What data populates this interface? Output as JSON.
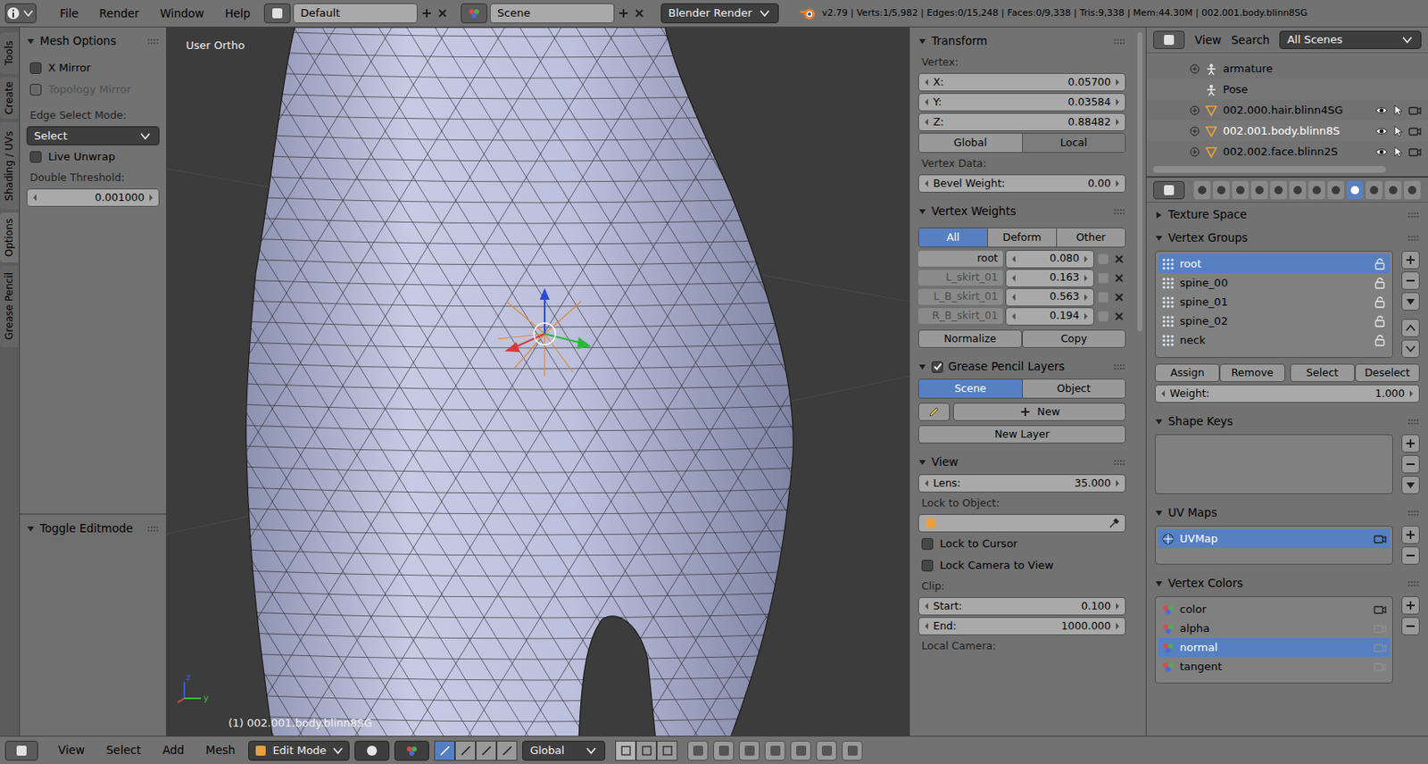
{
  "top_bar": {
    "menus": [
      "File",
      "Render",
      "Window",
      "Help"
    ],
    "layout": "Default",
    "scene": "Scene",
    "engine": "Blender Render",
    "stats": "v2.79 | Verts:1/5,982 | Edges:0/15,248 | Faces:0/9,338 | Tris:9,338 | Mem:44.30M | 002.001.body.blinn8SG"
  },
  "tool_tabs": [
    {
      "label": "Tools",
      "selected": false
    },
    {
      "label": "Create",
      "selected": false
    },
    {
      "label": "Shading / UVs",
      "selected": false
    },
    {
      "label": "Options",
      "selected": true
    },
    {
      "label": "Grease Pencil",
      "selected": false
    }
  ],
  "mesh_options": {
    "title": "Mesh Options",
    "expanded": true,
    "checkboxes": [
      {
        "label": "X Mirror",
        "checked": false,
        "disabled": false
      },
      {
        "label": "Topology Mirror",
        "checked": false,
        "disabled": true
      }
    ],
    "edge_select_label": "Edge Select Mode:",
    "edge_select_value": "Select",
    "live_unwrap": {
      "label": "Live Unwrap",
      "checked": false,
      "disabled": false
    },
    "threshold_label": "Double Threshold:",
    "threshold_value": "0.001000"
  },
  "operator_panel": {
    "title": "Toggle Editmode",
    "expanded": true
  },
  "viewport": {
    "view_name": "User Ortho",
    "object_info": "(1) 002.001.body.blinn8SG",
    "axis_labels": [
      "z",
      "y"
    ]
  },
  "transform": {
    "title": "Transform",
    "expanded": true,
    "vertex_label": "Vertex:",
    "coords": [
      {
        "label": "X:",
        "value": "0.05700"
      },
      {
        "label": "Y:",
        "value": "0.03584"
      },
      {
        "label": "Z:",
        "value": "0.88482"
      }
    ],
    "space": [
      {
        "label": "Global",
        "selected": false
      },
      {
        "label": "Local",
        "selected": true
      }
    ],
    "vertex_data_label": "Vertex Data:",
    "bevel": {
      "label": "Bevel Weight:",
      "value": "0.00"
    }
  },
  "vertex_weights": {
    "title": "Vertex Weights",
    "expanded": true,
    "filters": [
      {
        "label": "All",
        "selected": true
      },
      {
        "label": "Deform",
        "selected": false
      },
      {
        "label": "Other",
        "selected": false
      }
    ],
    "rows": [
      {
        "group": "root",
        "value": "0.080",
        "active": true
      },
      {
        "group": "L_skirt_01",
        "value": "0.163",
        "active": false
      },
      {
        "group": "L_B_skirt_01",
        "value": "0.563",
        "active": false
      },
      {
        "group": "R_B_skirt_01",
        "value": "0.194",
        "active": false
      }
    ],
    "buttons": [
      "Normalize",
      "Copy"
    ]
  },
  "grease_pencil": {
    "title": "Grease Pencil Layers",
    "expanded": true,
    "enabled": true,
    "source": [
      {
        "label": "Scene",
        "selected": true
      },
      {
        "label": "Object",
        "selected": false
      }
    ],
    "new_label": "New",
    "new_layer_label": "New Layer"
  },
  "view_panel": {
    "title": "View",
    "expanded": true,
    "lens": {
      "label": "Lens:",
      "value": "35.000"
    },
    "lock_object_label": "Lock to Object:",
    "checkboxes": [
      {
        "label": "Lock to Cursor",
        "checked": false
      },
      {
        "label": "Lock Camera to View",
        "checked": false
      }
    ],
    "clip_label": "Clip:",
    "clip": [
      {
        "label": "Start:",
        "value": "0.100"
      },
      {
        "label": "End:",
        "value": "1000.000"
      }
    ],
    "local_camera_label": "Local Camera:"
  },
  "outliner": {
    "menus": [
      "View",
      "Search"
    ],
    "filter": "All Scenes",
    "items": [
      {
        "name": "armature",
        "kind": "armature",
        "depth": 1,
        "expandable": true,
        "selected": false
      },
      {
        "name": "Pose",
        "kind": "pose",
        "depth": 1,
        "expandable": false,
        "selected": false
      },
      {
        "name": "002.000.hair.blinn4SG",
        "kind": "mesh",
        "depth": 1,
        "expandable": true,
        "selected": false
      },
      {
        "name": "002.001.body.blinn8S",
        "kind": "mesh",
        "depth": 1,
        "expandable": true,
        "selected": true
      },
      {
        "name": "002.002.face.blinn2S",
        "kind": "mesh",
        "depth": 1,
        "expandable": true,
        "selected": false
      }
    ]
  },
  "properties_tabs": [
    {
      "selected": false
    },
    {
      "selected": false
    },
    {
      "selected": false
    },
    {
      "selected": false
    },
    {
      "selected": false
    },
    {
      "selected": false
    },
    {
      "selected": false
    },
    {
      "selected": false
    },
    {
      "selected": true
    },
    {
      "selected": false
    },
    {
      "selected": false
    },
    {
      "selected": false
    }
  ],
  "properties": {
    "texture_space": {
      "title": "Texture Space",
      "expanded": false
    },
    "vertex_groups": {
      "title": "Vertex Groups",
      "expanded": true,
      "items": [
        {
          "name": "root",
          "selected": true
        },
        {
          "name": "spine_00",
          "selected": false
        },
        {
          "name": "spine_01",
          "selected": false
        },
        {
          "name": "spine_02",
          "selected": false
        },
        {
          "name": "neck",
          "selected": false
        }
      ],
      "buttons": [
        "Assign",
        "Remove",
        "Select",
        "Deselect"
      ],
      "weight": {
        "label": "Weight:",
        "value": "1.000"
      }
    },
    "shape_keys": {
      "title": "Shape Keys",
      "expanded": true
    },
    "uv_maps": {
      "title": "UV Maps",
      "expanded": true,
      "items": [
        {
          "name": "UVMap",
          "selected": true,
          "render": true
        }
      ]
    },
    "vertex_colors": {
      "title": "Vertex Colors",
      "expanded": true,
      "items": [
        {
          "name": "color",
          "selected": false,
          "render": true
        },
        {
          "name": "alpha",
          "selected": false,
          "render": false
        },
        {
          "name": "normal",
          "selected": true,
          "render": false
        },
        {
          "name": "tangent",
          "selected": false,
          "render": false
        }
      ]
    }
  },
  "bottom_bar": {
    "menus": [
      "View",
      "Select",
      "Add",
      "Mesh"
    ],
    "mode": "Edit Mode",
    "orientation": "Global",
    "manipulators": [
      {
        "selected": true
      },
      {
        "selected": false
      },
      {
        "selected": false
      },
      {
        "selected": false
      }
    ],
    "select_modes": [
      {
        "selected": true
      },
      {
        "selected": false
      },
      {
        "selected": false
      }
    ]
  }
}
